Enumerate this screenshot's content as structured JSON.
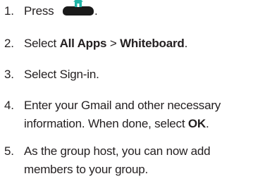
{
  "steps": [
    {
      "num": "1.",
      "pre": "Press",
      "icon": "home-icon",
      "post": "."
    },
    {
      "num": "2.",
      "pre": "Select ",
      "b1": "All Apps",
      "mid": " > ",
      "b2": "Whiteboard",
      "post": "."
    },
    {
      "num": "3.",
      "text": "Select Sign-in."
    },
    {
      "num": "4.",
      "line1": "Enter your Gmail and other necessary",
      "line2_pre": "information. When done, select ",
      "line2_bold": "OK",
      "line2_post": "."
    },
    {
      "num": "5.",
      "line1": "As the group host, you can now add",
      "line2": "members to your group."
    }
  ],
  "colors": {
    "text": "#231f20",
    "button": "#1a1a1a",
    "home_icon": "#1fb3a6"
  }
}
